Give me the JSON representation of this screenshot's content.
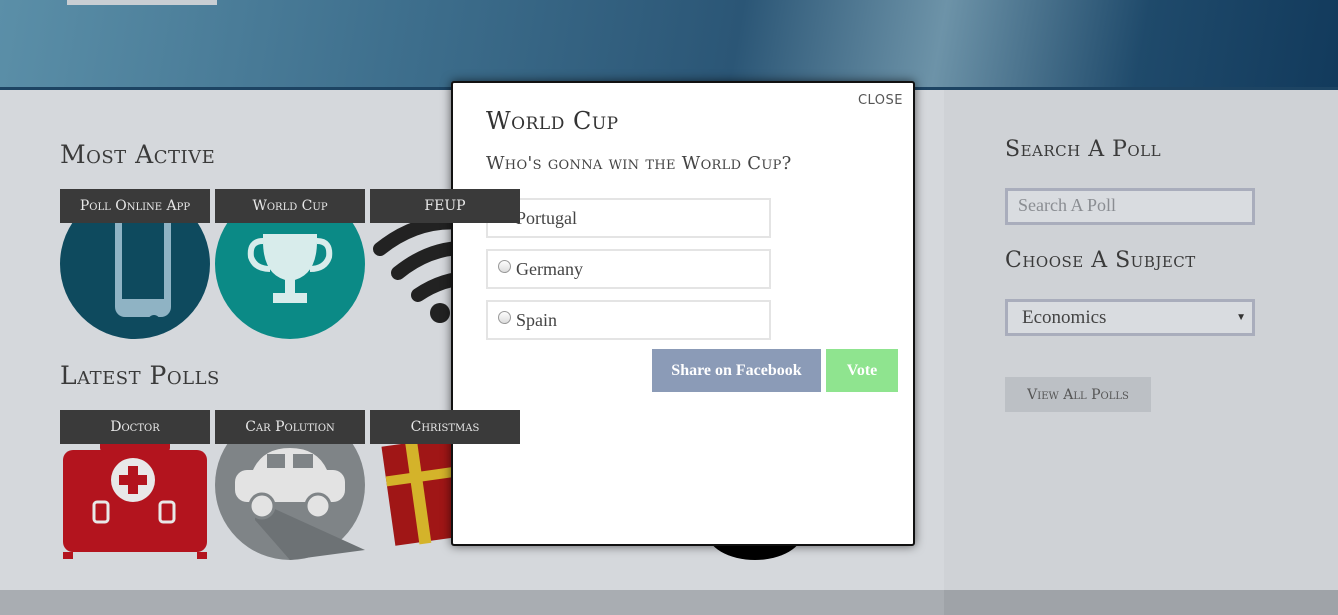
{
  "header": {
    "menu_button": ""
  },
  "most_active": {
    "heading": "Most Active",
    "items": [
      {
        "label": "Poll Online App",
        "icon": "phone-icon",
        "color": "#0e4a5e"
      },
      {
        "label": "World Cup",
        "icon": "trophy-icon",
        "color": "#0b8a86"
      },
      {
        "label": "FEUP",
        "icon": "wifi-icon",
        "color": "#222222"
      }
    ]
  },
  "latest_polls": {
    "heading": "Latest Polls",
    "items": [
      {
        "label": "Doctor",
        "icon": "medical-kit-icon",
        "color": "#b3141e"
      },
      {
        "label": "Car Polution",
        "icon": "car-icon",
        "color": "#7f8487"
      },
      {
        "label": "Christmas",
        "icon": "gift-icon",
        "color": "#a01616"
      }
    ]
  },
  "sidebar": {
    "search_heading": "Search A Poll",
    "search_placeholder": "Search A Poll",
    "subject_heading": "Choose A Subject",
    "subject_selected": "Economics",
    "view_all_label": "View All Polls"
  },
  "modal": {
    "close_label": "CLOSE",
    "title": "World Cup",
    "question": "Who's gonna win the World Cup?",
    "options": [
      "Portugal",
      "Germany",
      "Spain"
    ],
    "share_label": "Share on Facebook",
    "vote_label": "Vote",
    "colors": {
      "share": "#8b9bb7",
      "vote": "#8fe48f"
    }
  }
}
